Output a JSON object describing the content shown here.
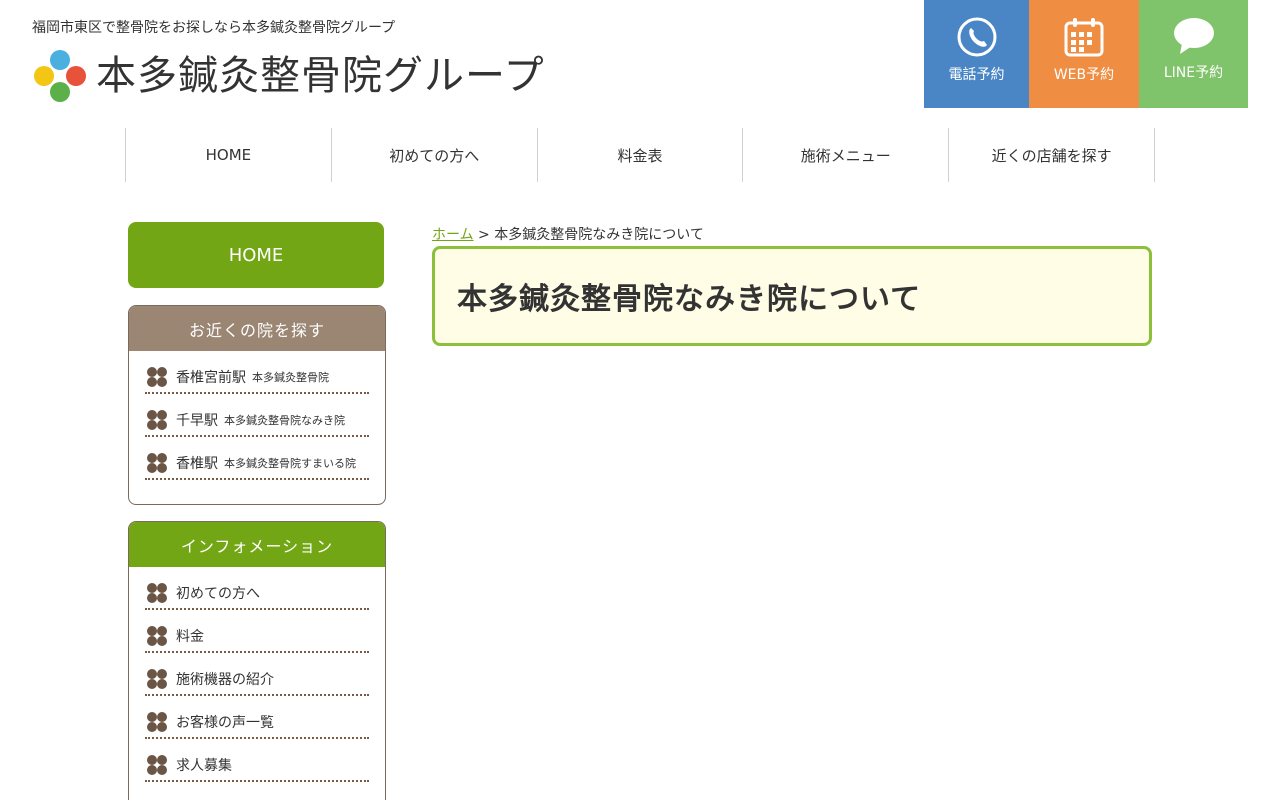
{
  "header": {
    "tagline": "福岡市東区で整骨院をお探しなら本多鍼灸整骨院グループ",
    "logo_text": "本多鍼灸整骨院グループ",
    "reserve": [
      {
        "label": "電話予約",
        "color": "#4a86c6"
      },
      {
        "label": "WEB予約",
        "color": "#ef8d43"
      },
      {
        "label": "LINE予約",
        "color": "#7fc36a"
      }
    ]
  },
  "nav": {
    "items": [
      "HOME",
      "初めての方へ",
      "料金表",
      "施術メニュー",
      "近くの店舗を探す"
    ]
  },
  "sidebar": {
    "home_label": "HOME",
    "find": {
      "heading": "お近くの院を探す",
      "items": [
        {
          "main": "香椎宮前駅",
          "sub": "本多鍼灸整骨院"
        },
        {
          "main": "千早駅",
          "sub": "本多鍼灸整骨院なみき院"
        },
        {
          "main": "香椎駅",
          "sub": "本多鍼灸整骨院すまいる院"
        }
      ]
    },
    "info": {
      "heading": "インフォメーション",
      "items": [
        "初めての方へ",
        "料金",
        "施術機器の紹介",
        "お客様の声一覧",
        "求人募集"
      ]
    }
  },
  "main": {
    "breadcrumb_home": "ホーム",
    "breadcrumb_sep": " > ",
    "breadcrumb_current": "本多鍼灸整骨院なみき院について",
    "title": "本多鍼灸整骨院なみき院について"
  },
  "colors": {
    "accent_green": "#72a614",
    "find_header": "#9b8573",
    "title_bg": "#fffde6"
  }
}
